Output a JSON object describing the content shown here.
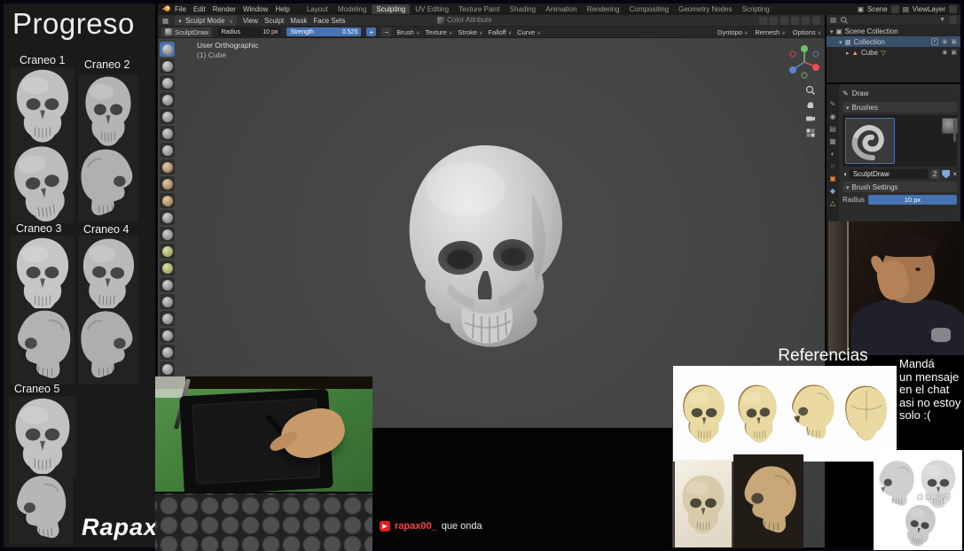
{
  "progress_panel": {
    "title": "Progreso",
    "labels": [
      "Craneo 1",
      "Craneo 2",
      "Craneo 3",
      "Craneo 4",
      "Craneo 5"
    ],
    "signature": "Rapax"
  },
  "blender": {
    "topbar": {
      "menus": [
        "File",
        "Edit",
        "Render",
        "Window",
        "Help"
      ],
      "workspaces": [
        "Layout",
        "Modeling",
        "Sculpting",
        "UV Editing",
        "Texture Paint",
        "Shading",
        "Animation",
        "Rendering",
        "Compositing",
        "Geometry Nodes",
        "Scripting"
      ],
      "active_workspace": "Sculpting",
      "scene_name": "Scene",
      "viewlayer_name": "ViewLayer"
    },
    "mode_header": {
      "mode": "Sculpt Mode",
      "menus": [
        "View",
        "Sculpt",
        "Mask",
        "Face Sets"
      ],
      "center_label": "Color Attribute"
    },
    "tool_header": {
      "brush_name": "SculptDraw",
      "radius_label": "Radius",
      "radius_value": "10 px",
      "strength_label": "Strength",
      "strength_value": "0.525",
      "dropdowns": [
        "Brush",
        "Texture",
        "Stroke",
        "Falloff",
        "Curve"
      ],
      "right_dropdowns": [
        "Dyntopo",
        "Remesh",
        "Options"
      ]
    },
    "viewport": {
      "view_label": "User Orthographic",
      "object_label": "(1) Cube"
    },
    "outliner": {
      "scene_collection": "Scene Collection",
      "collection": "Collection",
      "object_name": "Cube"
    },
    "properties": {
      "active_tool": "Draw",
      "brushes_section": "Brushes",
      "brush_name": "SculptDraw",
      "brush_users": "2",
      "settings_section": "Brush Settings",
      "radius_label": "Radius",
      "radius_value": "10 px"
    }
  },
  "overlays": {
    "referencias_title": "Referencias",
    "watermark": "@123RF",
    "message_lines": [
      "Mandá",
      "un mensaje",
      "en el chat",
      "asi no estoy",
      "solo :("
    ],
    "chat_username": "rapax00_",
    "chat_message": "que onda"
  },
  "icons": {
    "chevron": "∨",
    "play": "▶",
    "close": "×",
    "check": "✓"
  },
  "colors": {
    "slider_blue": "#4772b3",
    "chat_red": "#ff4545",
    "mesh_orange": "#ff9a3c",
    "viewport_gray": "#454545"
  }
}
